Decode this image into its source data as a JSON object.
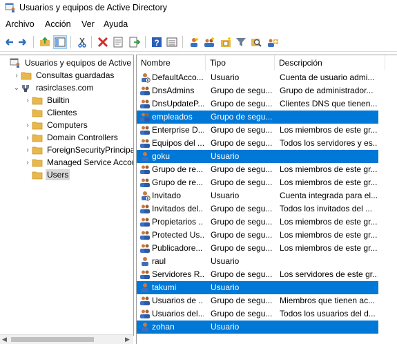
{
  "window": {
    "title": "Usuarios y equipos de Active Directory"
  },
  "menu": [
    {
      "label": "Archivo"
    },
    {
      "label": "Acción"
    },
    {
      "label": "Ver"
    },
    {
      "label": "Ayuda"
    }
  ],
  "toolbar": [
    {
      "name": "back-arrow-icon"
    },
    {
      "name": "forward-arrow-icon"
    },
    {
      "name": "up-folder-icon"
    },
    {
      "name": "show-tree-icon",
      "pressed": true
    },
    {
      "name": "cut-icon"
    },
    {
      "name": "delete-icon"
    },
    {
      "name": "properties-icon"
    },
    {
      "name": "export-list-icon"
    },
    {
      "name": "help-icon"
    },
    {
      "name": "details-view-icon"
    },
    {
      "name": "new-user-icon"
    },
    {
      "name": "new-group-icon"
    },
    {
      "name": "new-ou-icon"
    },
    {
      "name": "filter-icon"
    },
    {
      "name": "find-icon"
    },
    {
      "name": "add-to-group-icon"
    }
  ],
  "tree": [
    {
      "label": "Usuarios y equipos de Active Dire",
      "icon": "console",
      "depth": 0,
      "toggle": ""
    },
    {
      "label": "Consultas guardadas",
      "icon": "folder",
      "depth": 1,
      "toggle": "›"
    },
    {
      "label": "rasirclases.com",
      "icon": "domain",
      "depth": 1,
      "toggle": "⌄"
    },
    {
      "label": "Builtin",
      "icon": "folder",
      "depth": 2,
      "toggle": "›"
    },
    {
      "label": "Clientes",
      "icon": "folder",
      "depth": 2,
      "toggle": ""
    },
    {
      "label": "Computers",
      "icon": "folder",
      "depth": 2,
      "toggle": "›"
    },
    {
      "label": "Domain Controllers",
      "icon": "folder",
      "depth": 2,
      "toggle": "›"
    },
    {
      "label": "ForeignSecurityPrincipals",
      "icon": "folder",
      "depth": 2,
      "toggle": "›"
    },
    {
      "label": "Managed Service Accour",
      "icon": "folder",
      "depth": 2,
      "toggle": "›"
    },
    {
      "label": "Users",
      "icon": "folder",
      "depth": 2,
      "toggle": "",
      "selected": true
    }
  ],
  "list": {
    "columns": [
      "Nombre",
      "Tipo",
      "Descripción"
    ],
    "rows": [
      {
        "name": "DefaultAcco...",
        "type": "Usuario",
        "desc": "Cuenta de usuario admi...",
        "icon": "user-disabled"
      },
      {
        "name": "DnsAdmins",
        "type": "Grupo de segu...",
        "desc": "Grupo de administrador...",
        "icon": "group"
      },
      {
        "name": "DnsUpdateP...",
        "type": "Grupo de segu...",
        "desc": "Clientes DNS que tienen...",
        "icon": "group"
      },
      {
        "name": "empleados",
        "type": "Grupo de segu...",
        "desc": "",
        "icon": "group",
        "selected": true
      },
      {
        "name": "Enterprise D...",
        "type": "Grupo de segu...",
        "desc": "Los miembros de este gr...",
        "icon": "group"
      },
      {
        "name": "Equipos del ...",
        "type": "Grupo de segu...",
        "desc": "Todos los servidores y es...",
        "icon": "group"
      },
      {
        "name": "goku",
        "type": "Usuario",
        "desc": "",
        "icon": "user",
        "selected": true
      },
      {
        "name": "Grupo de re...",
        "type": "Grupo de segu...",
        "desc": "Los miembros de este gr...",
        "icon": "group"
      },
      {
        "name": "Grupo de re...",
        "type": "Grupo de segu...",
        "desc": "Los miembros de este gr...",
        "icon": "group"
      },
      {
        "name": "Invitado",
        "type": "Usuario",
        "desc": "Cuenta integrada para el...",
        "icon": "user-disabled"
      },
      {
        "name": "Invitados del...",
        "type": "Grupo de segu...",
        "desc": "Todos los invitados del ...",
        "icon": "group"
      },
      {
        "name": "Propietarios ...",
        "type": "Grupo de segu...",
        "desc": "Los miembros de este gr...",
        "icon": "group"
      },
      {
        "name": "Protected Us...",
        "type": "Grupo de segu...",
        "desc": "Los miembros de este gr...",
        "icon": "group"
      },
      {
        "name": "Publicadore...",
        "type": "Grupo de segu...",
        "desc": "Los miembros de este gr...",
        "icon": "group"
      },
      {
        "name": "raul",
        "type": "Usuario",
        "desc": "",
        "icon": "user"
      },
      {
        "name": "Servidores R...",
        "type": "Grupo de segu...",
        "desc": "Los servidores de este gr...",
        "icon": "group"
      },
      {
        "name": "takumi",
        "type": "Usuario",
        "desc": "",
        "icon": "user",
        "selected": true
      },
      {
        "name": "Usuarios de ...",
        "type": "Grupo de segu...",
        "desc": "Miembros que tienen ac...",
        "icon": "group"
      },
      {
        "name": "Usuarios del...",
        "type": "Grupo de segu...",
        "desc": "Todos los usuarios del d...",
        "icon": "group"
      },
      {
        "name": "zohan",
        "type": "Usuario",
        "desc": "",
        "icon": "user",
        "selected": true
      }
    ]
  },
  "colors": {
    "selection": "#0078d7",
    "tree_selection": "#d9d9d9",
    "folder": "#e8b84a"
  }
}
